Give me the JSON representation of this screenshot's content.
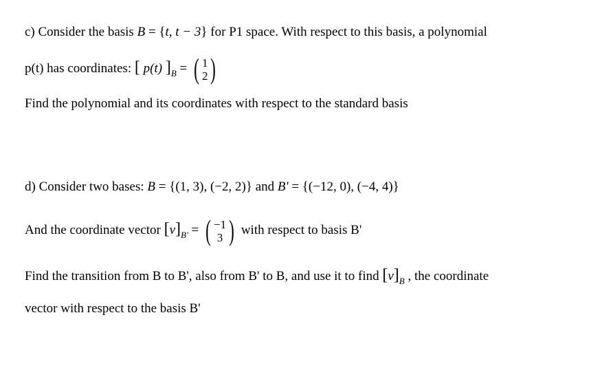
{
  "partC": {
    "line1_prefix": "c) Consider the basis ",
    "line1_basis_lhs": "B",
    "line1_basis_rhs": " = {",
    "line1_basis_contents": "t, t − 3",
    "line1_basis_close": "} ",
    "line1_suffix": " for P1 space. With respect to this basis, a polynomial",
    "line2_prefix": "p(t) has coordinates: ",
    "line2_lbracket": "[",
    "line2_inner": "p(t)",
    "line2_rbracket": "]",
    "line2_sub": "B",
    "line2_eq": " = ",
    "vec_top": "1",
    "vec_bot": "2",
    "line3": "Find the polynomial and its coordinates with respect to the standard basis"
  },
  "partD": {
    "line1_prefix": "d) Consider two bases: ",
    "line1_B_lhs": "B",
    "line1_B_eq": " = {(1, 3), (−2, 2)} ",
    "line1_and": " and ",
    "line1_Bp_lhs": "B'",
    "line1_Bp_eq": " = {(−12, 0), (−4, 4)}",
    "line2_prefix": "And the coordinate vector ",
    "line2_lbracket": "[",
    "line2_inner": "v",
    "line2_rbracket": "]",
    "line2_sub": "B'",
    "line2_eq": " = ",
    "vec_top": "−1",
    "vec_bot": "3",
    "line2_suffix": " with respect to basis B'",
    "line3_a": "Find the transition from B to B', also from B' to B, and use it to find ",
    "line3_lbracket": "[",
    "line3_inner": "v",
    "line3_rbracket": "]",
    "line3_sub": "B",
    "line3_suffix": " , the coordinate",
    "line4": "vector with respect to the basis B'"
  }
}
